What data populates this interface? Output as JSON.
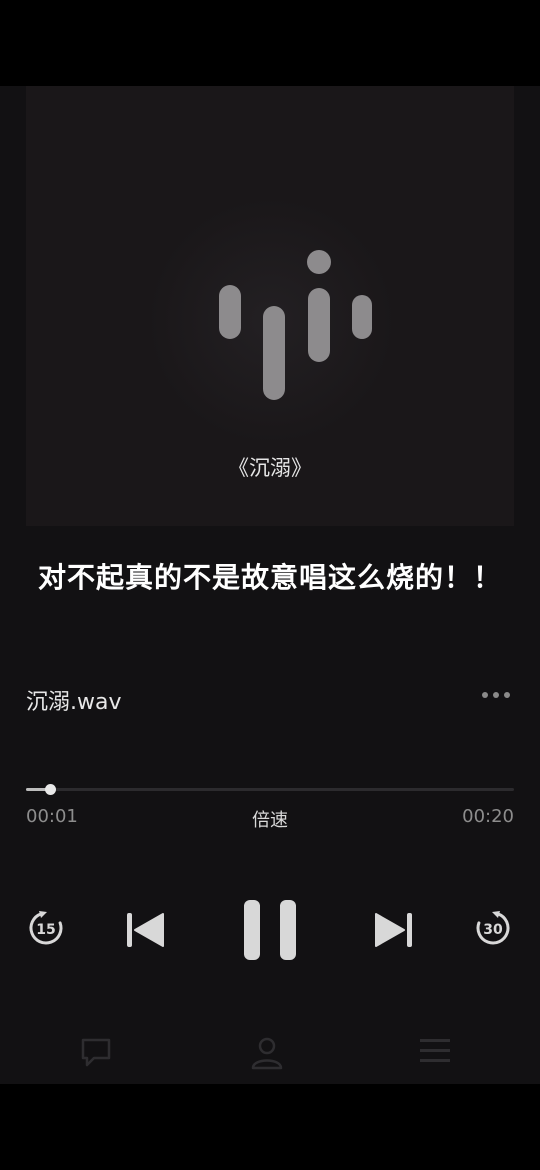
{
  "album_title": "《沉溺》",
  "caption": "对不起真的不是故意唱这么烧的！！",
  "track": {
    "file_name": "沉溺.wav",
    "elapsed": "00:01",
    "duration": "00:20",
    "progress": 0.05,
    "speed_label": "倍速"
  },
  "controls": {
    "rewind_seconds": "15",
    "forward_seconds": "30"
  },
  "icons": [
    "podcast-logo-icon",
    "more-icon",
    "rewind-15-icon",
    "previous-icon",
    "pause-icon",
    "next-icon",
    "forward-30-icon",
    "chat-icon",
    "profile-icon",
    "menu-icon"
  ],
  "colors": {
    "background": "#121113",
    "artwork": "#1a1719",
    "logo": "#8d8b8d",
    "muted_text": "#8d8d8d",
    "control": "#d8d8d8"
  }
}
